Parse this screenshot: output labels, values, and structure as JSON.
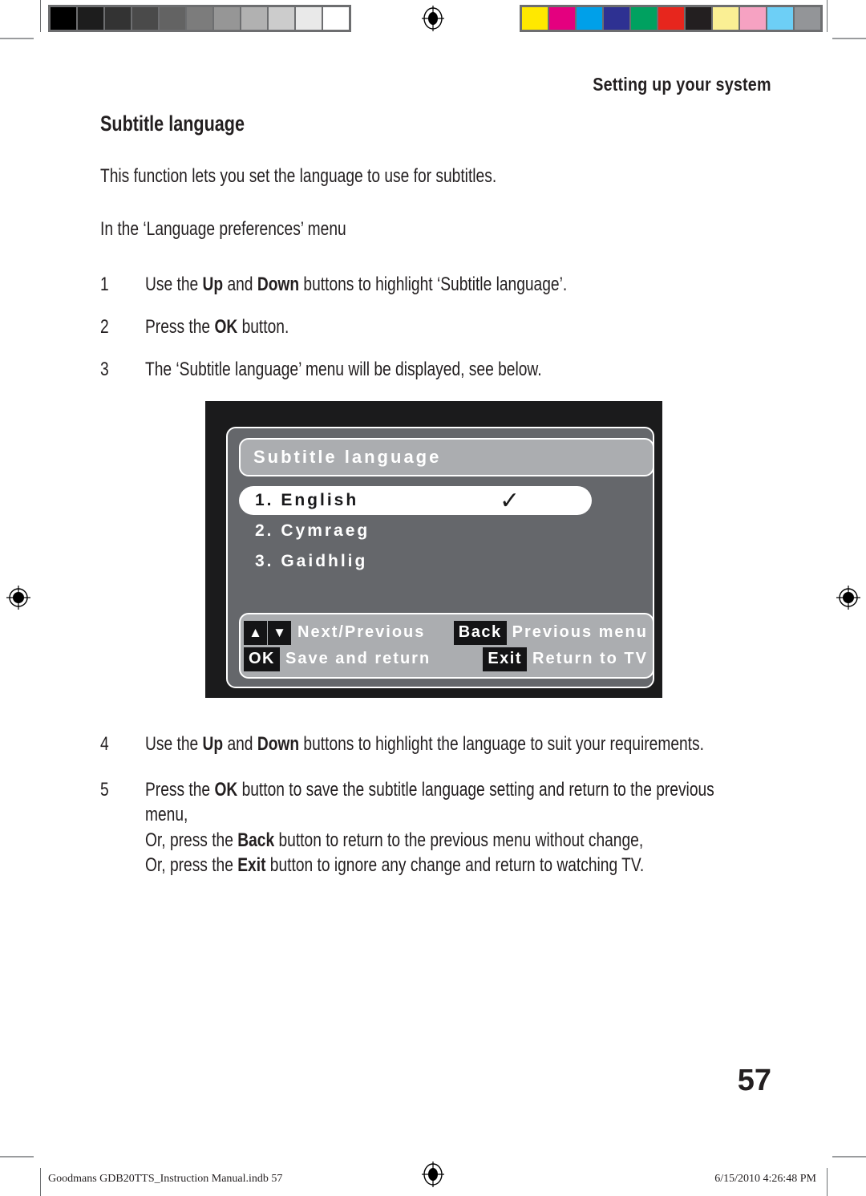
{
  "calibration": {
    "gray_strip_name": "grayscale-calibration-strip",
    "gray_patches": [
      "#000000",
      "#1d1d1d",
      "#333333",
      "#4a4a4a",
      "#636363",
      "#7c7c7c",
      "#969696",
      "#b1b1b1",
      "#cccccc",
      "#e9e9e9",
      "#ffffff"
    ],
    "color_strip_name": "color-calibration-strip",
    "color_patches": [
      "#ffe800",
      "#e4007f",
      "#00a0e9",
      "#2e3192",
      "#00a160",
      "#e7261d",
      "#231f20",
      "#faef94",
      "#f6a2c2",
      "#6dcff6",
      "#939598"
    ]
  },
  "header": {
    "running_head": "Setting up your system"
  },
  "content": {
    "section_title": "Subtitle language",
    "intro": "This function lets you set the language to use for subtitles.",
    "context": "In the ‘Language preferences’ menu",
    "steps_upper": [
      {
        "num": "1",
        "parts": [
          {
            "t": "Use the ",
            "b": false
          },
          {
            "t": "Up",
            "b": true
          },
          {
            "t": " and ",
            "b": false
          },
          {
            "t": "Down",
            "b": true
          },
          {
            "t": " buttons to highlight ‘Subtitle language’.",
            "b": false
          }
        ]
      },
      {
        "num": "2",
        "parts": [
          {
            "t": "Press the ",
            "b": false
          },
          {
            "t": "OK",
            "b": true
          },
          {
            "t": " button.",
            "b": false
          }
        ]
      },
      {
        "num": "3",
        "parts": [
          {
            "t": "The ‘Subtitle language’ menu will be displayed, see below.",
            "b": false
          }
        ]
      }
    ],
    "steps_lower": [
      {
        "num": "4",
        "lines": [
          [
            {
              "t": "Use the ",
              "b": false
            },
            {
              "t": "Up",
              "b": true
            },
            {
              "t": " and ",
              "b": false
            },
            {
              "t": "Down",
              "b": true
            },
            {
              "t": " buttons to highlight the language to suit your requirements.",
              "b": false
            }
          ]
        ]
      },
      {
        "num": "5",
        "lines": [
          [
            {
              "t": "Press the ",
              "b": false
            },
            {
              "t": "OK",
              "b": true
            },
            {
              "t": " button to save the subtitle language setting and return to the previous",
              "b": false
            }
          ],
          [
            {
              "t": "menu,",
              "b": false
            }
          ],
          [
            {
              "t": "Or, press the ",
              "b": false
            },
            {
              "t": "Back",
              "b": true
            },
            {
              "t": " button to return to the previous menu without change,",
              "b": false
            }
          ],
          [
            {
              "t": "Or, press the ",
              "b": false
            },
            {
              "t": "Exit",
              "b": true
            },
            {
              "t": " button to ignore any change and return to watching TV.",
              "b": false
            }
          ]
        ]
      }
    ]
  },
  "osd": {
    "title": "Subtitle language",
    "items": [
      {
        "label": "1. English",
        "selected": true,
        "tick": "✓"
      },
      {
        "label": "2. Cymraeg",
        "selected": false,
        "tick": ""
      },
      {
        "label": "3. Gaidhlig",
        "selected": false,
        "tick": ""
      }
    ],
    "help": {
      "row1_key_up": "▲",
      "row1_key_down": "▼",
      "row1_label": "Next/Previous",
      "row1_key_right": "Back",
      "row1_label_right": "Previous menu",
      "row2_key": "OK",
      "row2_label": "Save and return",
      "row2_key_right": "Exit",
      "row2_label_right": "Return to TV"
    },
    "colors": {
      "frame": "#1b1b1c",
      "panel": "#65676b",
      "bar": "#abadb0",
      "keycap": "#141416",
      "selected_bg": "#ffffff"
    }
  },
  "page": {
    "number": "57"
  },
  "footer": {
    "left": "Goodmans GDB20TTS_Instruction Manual.indb   57",
    "right": "6/15/2010   4:26:48 PM"
  }
}
